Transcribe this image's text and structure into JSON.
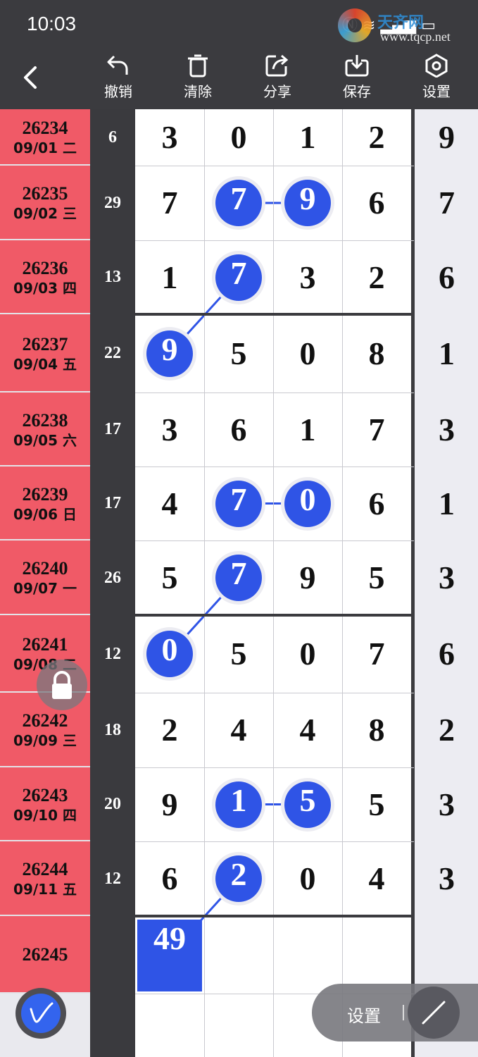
{
  "status_bar": {
    "time": "10:03",
    "icons": [
      "nfc-icon",
      "wifi-icon",
      "signal-icon",
      "battery-icon"
    ]
  },
  "watermark": {
    "text": "天齐网",
    "url": "www.tqcp.net"
  },
  "toolbar": {
    "undo": "撤销",
    "clear": "清除",
    "share": "分享",
    "save": "保存",
    "settings": "设置"
  },
  "colors": {
    "issue_bg": "#f05a67",
    "highlight": "#2f54e6",
    "dark": "#3b3b3f"
  },
  "rows": [
    {
      "issue": "26234",
      "date": "09/01 二",
      "sum": "6",
      "digits": [
        "3",
        "0",
        "1",
        "2"
      ],
      "extra": "9"
    },
    {
      "issue": "26235",
      "date": "09/02 三",
      "sum": "29",
      "digits": [
        "7",
        "7",
        "9",
        "6"
      ],
      "extra": "7"
    },
    {
      "issue": "26236",
      "date": "09/03 四",
      "sum": "13",
      "digits": [
        "1",
        "7",
        "3",
        "2"
      ],
      "extra": "6"
    },
    {
      "issue": "26237",
      "date": "09/04 五",
      "sum": "22",
      "digits": [
        "9",
        "5",
        "0",
        "8"
      ],
      "extra": "1"
    },
    {
      "issue": "26238",
      "date": "09/05 六",
      "sum": "17",
      "digits": [
        "3",
        "6",
        "1",
        "7"
      ],
      "extra": "3"
    },
    {
      "issue": "26239",
      "date": "09/06 日",
      "sum": "17",
      "digits": [
        "4",
        "7",
        "0",
        "6"
      ],
      "extra": "1"
    },
    {
      "issue": "26240",
      "date": "09/07 一",
      "sum": "26",
      "digits": [
        "5",
        "7",
        "9",
        "5"
      ],
      "extra": "3"
    },
    {
      "issue": "26241",
      "date": "09/08 二",
      "sum": "12",
      "digits": [
        "0",
        "5",
        "0",
        "7"
      ],
      "extra": "6"
    },
    {
      "issue": "26242",
      "date": "09/09 三",
      "sum": "18",
      "digits": [
        "2",
        "4",
        "4",
        "8"
      ],
      "extra": "2"
    },
    {
      "issue": "26243",
      "date": "09/10 四",
      "sum": "20",
      "digits": [
        "9",
        "1",
        "5",
        "5"
      ],
      "extra": "3"
    },
    {
      "issue": "26244",
      "date": "09/11 五",
      "sum": "12",
      "digits": [
        "6",
        "2",
        "0",
        "4"
      ],
      "extra": "3"
    },
    {
      "issue": "26245",
      "date": "",
      "sum": "",
      "digits": [
        "49",
        "",
        "",
        ""
      ],
      "extra": ""
    }
  ],
  "floating": {
    "settings_label": "设置"
  }
}
